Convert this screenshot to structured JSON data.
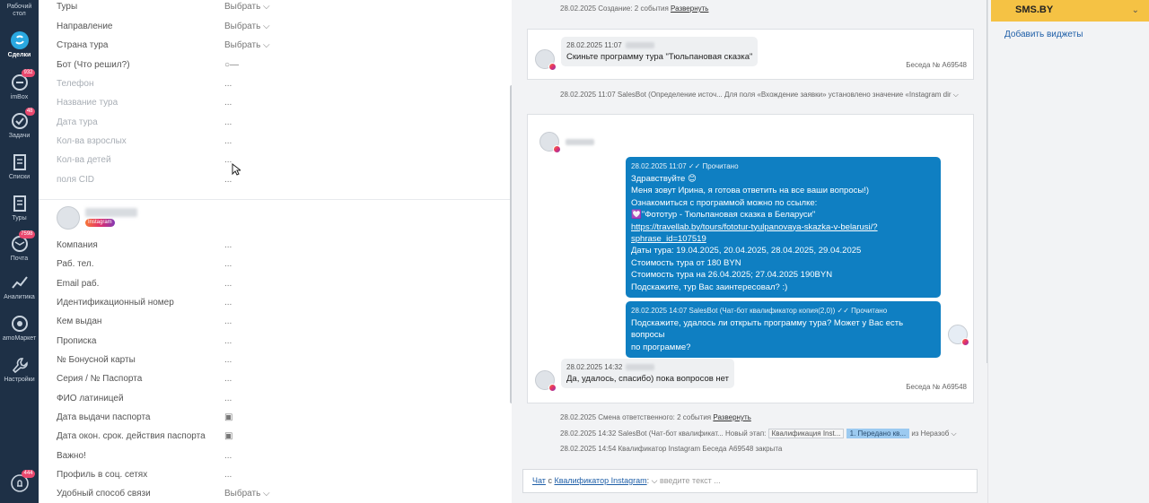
{
  "nav": [
    {
      "label": "Рабочий стол",
      "badge": ""
    },
    {
      "label": "Сделки",
      "badge": ""
    },
    {
      "label": "imBox",
      "badge": "932"
    },
    {
      "label": "Задачи",
      "badge": "48"
    },
    {
      "label": "Списки",
      "badge": ""
    },
    {
      "label": "Туры",
      "badge": ""
    },
    {
      "label": "Почта",
      "badge": "7598"
    },
    {
      "label": "Аналитика",
      "badge": ""
    },
    {
      "label": "amoМаркет",
      "badge": ""
    },
    {
      "label": "Настройки",
      "badge": ""
    },
    {
      "label": "",
      "badge": "444"
    }
  ],
  "lead_fields": [
    {
      "label": "Туры",
      "value": "Выбрать ⌵"
    },
    {
      "label": "Направление",
      "value": "Выбрать ⌵"
    },
    {
      "label": "Страна тура",
      "value": "Выбрать ⌵"
    },
    {
      "label": "Бот (Что решил?)",
      "value": "○—"
    },
    {
      "label": "Телефон",
      "value": "..."
    },
    {
      "label": "Название тура",
      "value": "..."
    },
    {
      "label": "Дата тура",
      "value": "..."
    },
    {
      "label": "Кол-ва взрослых",
      "value": "..."
    },
    {
      "label": "Кол-ва детей",
      "value": "..."
    },
    {
      "label": "поля CID",
      "value": "..."
    }
  ],
  "contact": {
    "source_badge": "Instagram"
  },
  "contact_fields": [
    {
      "label": "Компания",
      "value": "..."
    },
    {
      "label": "Раб. тел.",
      "value": "..."
    },
    {
      "label": "Email раб.",
      "value": "..."
    },
    {
      "label": "Идентификационный номер",
      "value": "..."
    },
    {
      "label": "Кем выдан",
      "value": "..."
    },
    {
      "label": "Прописка",
      "value": "..."
    },
    {
      "label": "№ Бонусной карты",
      "value": "..."
    },
    {
      "label": "Серия / № Паспорта",
      "value": "..."
    },
    {
      "label": "ФИО латиницей",
      "value": "..."
    },
    {
      "label": "Дата выдачи паспорта",
      "value": "▣"
    },
    {
      "label": "Дата окон. срок. действия паспорта",
      "value": "▣"
    },
    {
      "label": "Важно!",
      "value": "..."
    },
    {
      "label": "Профиль в соц. сетях",
      "value": "..."
    },
    {
      "label": "Удобный способ связи",
      "value": "Выбрать ⌵"
    }
  ],
  "chat": {
    "sys_top": "28.02.2025 Создание: 2 события",
    "sys_top_link": "Развернуть",
    "msg1": {
      "time": "28.02.2025 11:07",
      "text": "Скиньте программу тура \"Тюльпановая сказка\"",
      "conv": "Беседа № A69548"
    },
    "sys_salesbot": "28.02.2025 11:07 SalesBot (Определение источ... Для поля «Вхождение заявки» установлено значение «Instagram dir ⌵",
    "out1": {
      "meta": "28.02.2025 11:07  ✓✓ Прочитано",
      "lines": [
        "Здравствуйте 😊",
        "Меня зовут Ирина, я готова ответить на все ваши вопросы!)",
        "Ознакомиться с программой можно по ссылке:",
        "💟\"Фототур - Тюльпановая сказка в Беларуси\""
      ],
      "link1": "https://travellab.by/tours/fototur-tyulpanovaya-skazka-v-belarusi/?",
      "link2": "sphrase_id=107519",
      "lines2": [
        "Даты тура: 19.04.2025, 20.04.2025, 28.04.2025, 29.04.2025",
        "Стоимость тура от 180 BYN",
        "Стоимость тура на 26.04.2025; 27.04.2025 190BYN",
        "Подскажите, тур Вас заинтересовал? :)"
      ]
    },
    "out2": {
      "meta": "28.02.2025 14:07 SalesBot (Чат-бот квалификатор копия(2,0))  ✓✓ Прочитано",
      "line1": "Подскажите, удалось ли открыть программу тура? Может у Вас есть вопросы",
      "line2": "по программе?"
    },
    "msg2": {
      "time": "28.02.2025 14:32",
      "text": "Да, удалось, спасибо) пока вопросов нет",
      "conv": "Беседа № A69548"
    },
    "sys_resp": "28.02.2025 Смена ответственного: 2 события",
    "sys_resp_link": "Развернуть",
    "sys_stage_pre": "28.02.2025 14:32 SalesBot (Чат-бот квалификат... Новый этап:",
    "stage_a": "Квалификация Inst...",
    "stage_b": "1. Передано кв...",
    "sys_stage_post": "из Неразоб ⌵",
    "sys_closed": "28.02.2025 14:54 Квалификатор Instagram Беседа A69548 закрыта",
    "input_chat": "Чат",
    "input_with": "с",
    "input_target": "Квалификатор Instagram",
    "input_placeholder": "введите текст ..."
  },
  "right": {
    "sms_logo": "SMS.BY",
    "add_widgets": "Добавить виджеты"
  }
}
